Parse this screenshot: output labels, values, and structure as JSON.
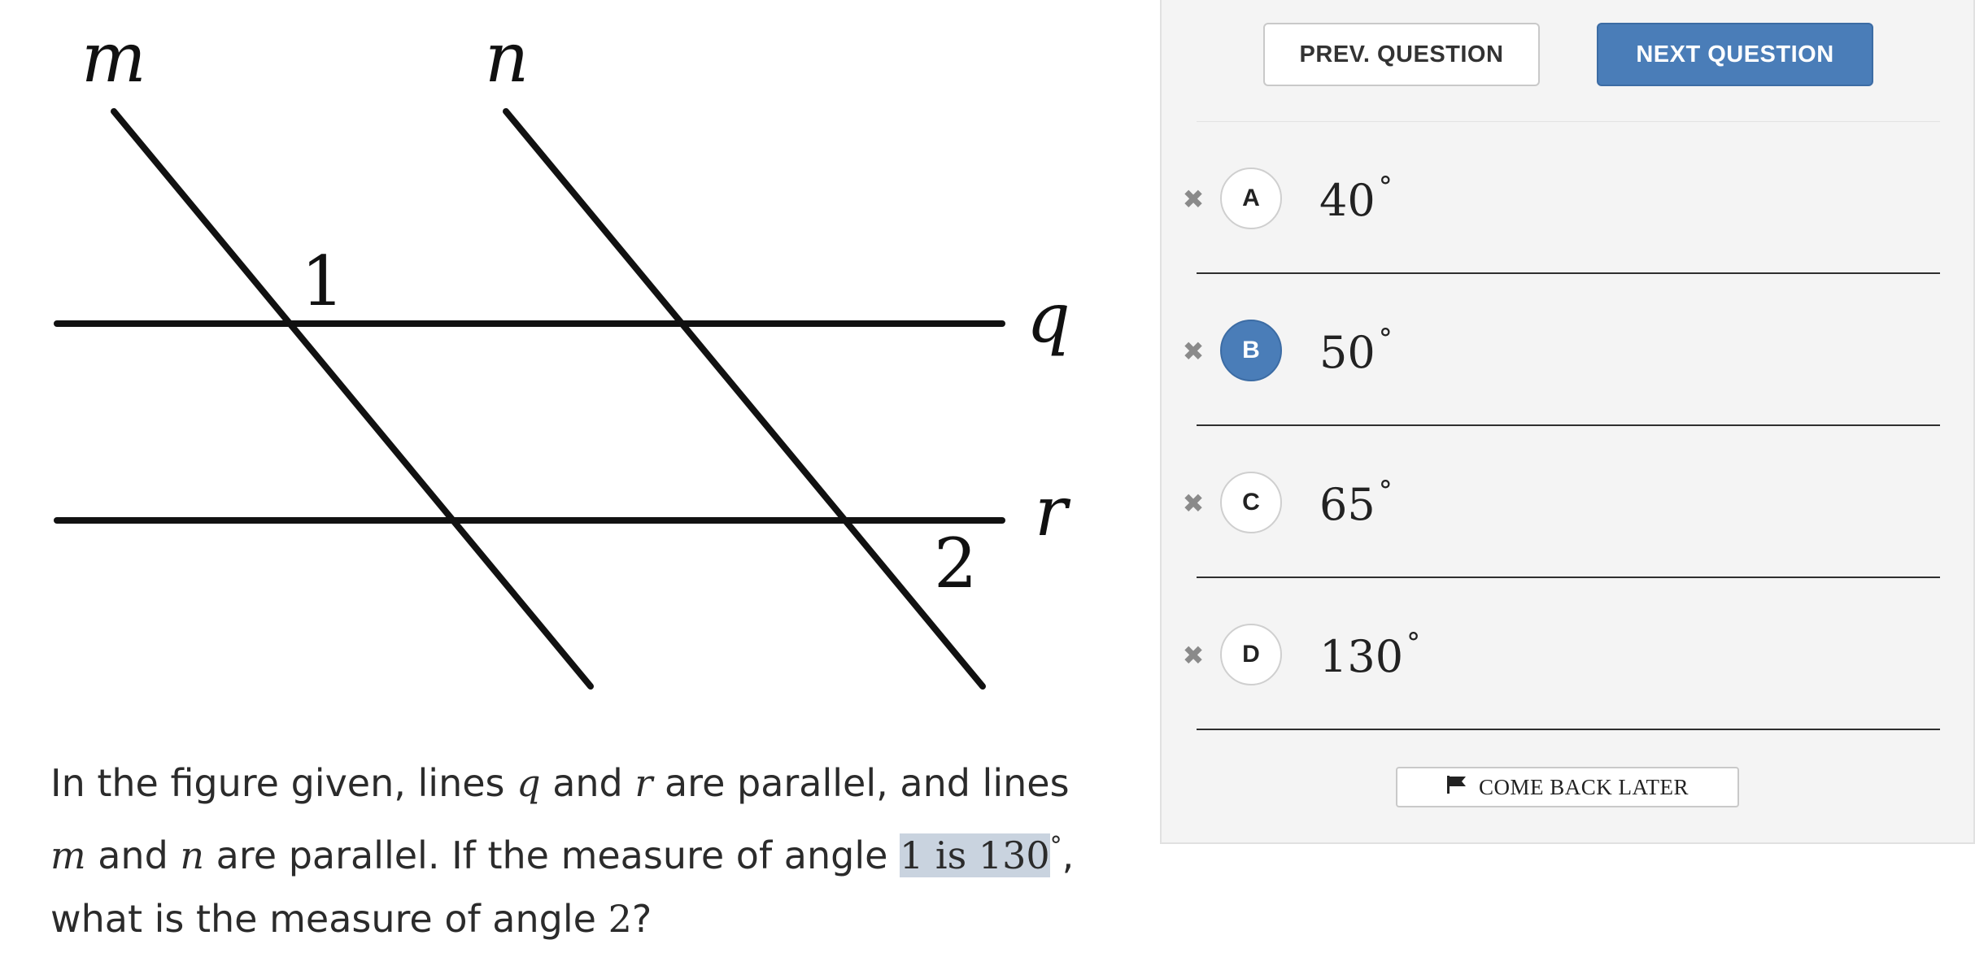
{
  "figure": {
    "line_labels": {
      "m": "m",
      "n": "n",
      "q": "q",
      "r": "r"
    },
    "angle_labels": {
      "one": "1",
      "two": "2"
    }
  },
  "question": {
    "t1": "In the figure given, lines ",
    "v_q": "q",
    "t2": " and ",
    "v_r": "r",
    "t3": " are parallel, and lines ",
    "v_m": "m",
    "t4": " and ",
    "v_n": "n",
    "t5": " are parallel. If the measure of angle ",
    "hl": "1 is 130",
    "deg": "°",
    "t6": ", what is the measure of angle ",
    "num_2": "2",
    "t7": "?"
  },
  "nav": {
    "prev_label": "PREV. QUESTION",
    "next_label": "NEXT QUESTION"
  },
  "options": [
    {
      "letter": "A",
      "value": "40",
      "unit": "°",
      "selected": false
    },
    {
      "letter": "B",
      "value": "50",
      "unit": "°",
      "selected": true
    },
    {
      "letter": "C",
      "value": "65",
      "unit": "°",
      "selected": false
    },
    {
      "letter": "D",
      "value": "130",
      "unit": "°",
      "selected": false
    }
  ],
  "come_back": {
    "label": "COME BACK LATER",
    "icon": "flag-icon"
  },
  "colors": {
    "accent": "#4a7db8",
    "panel_bg": "#f4f4f4",
    "highlight": "#c9d3df"
  }
}
